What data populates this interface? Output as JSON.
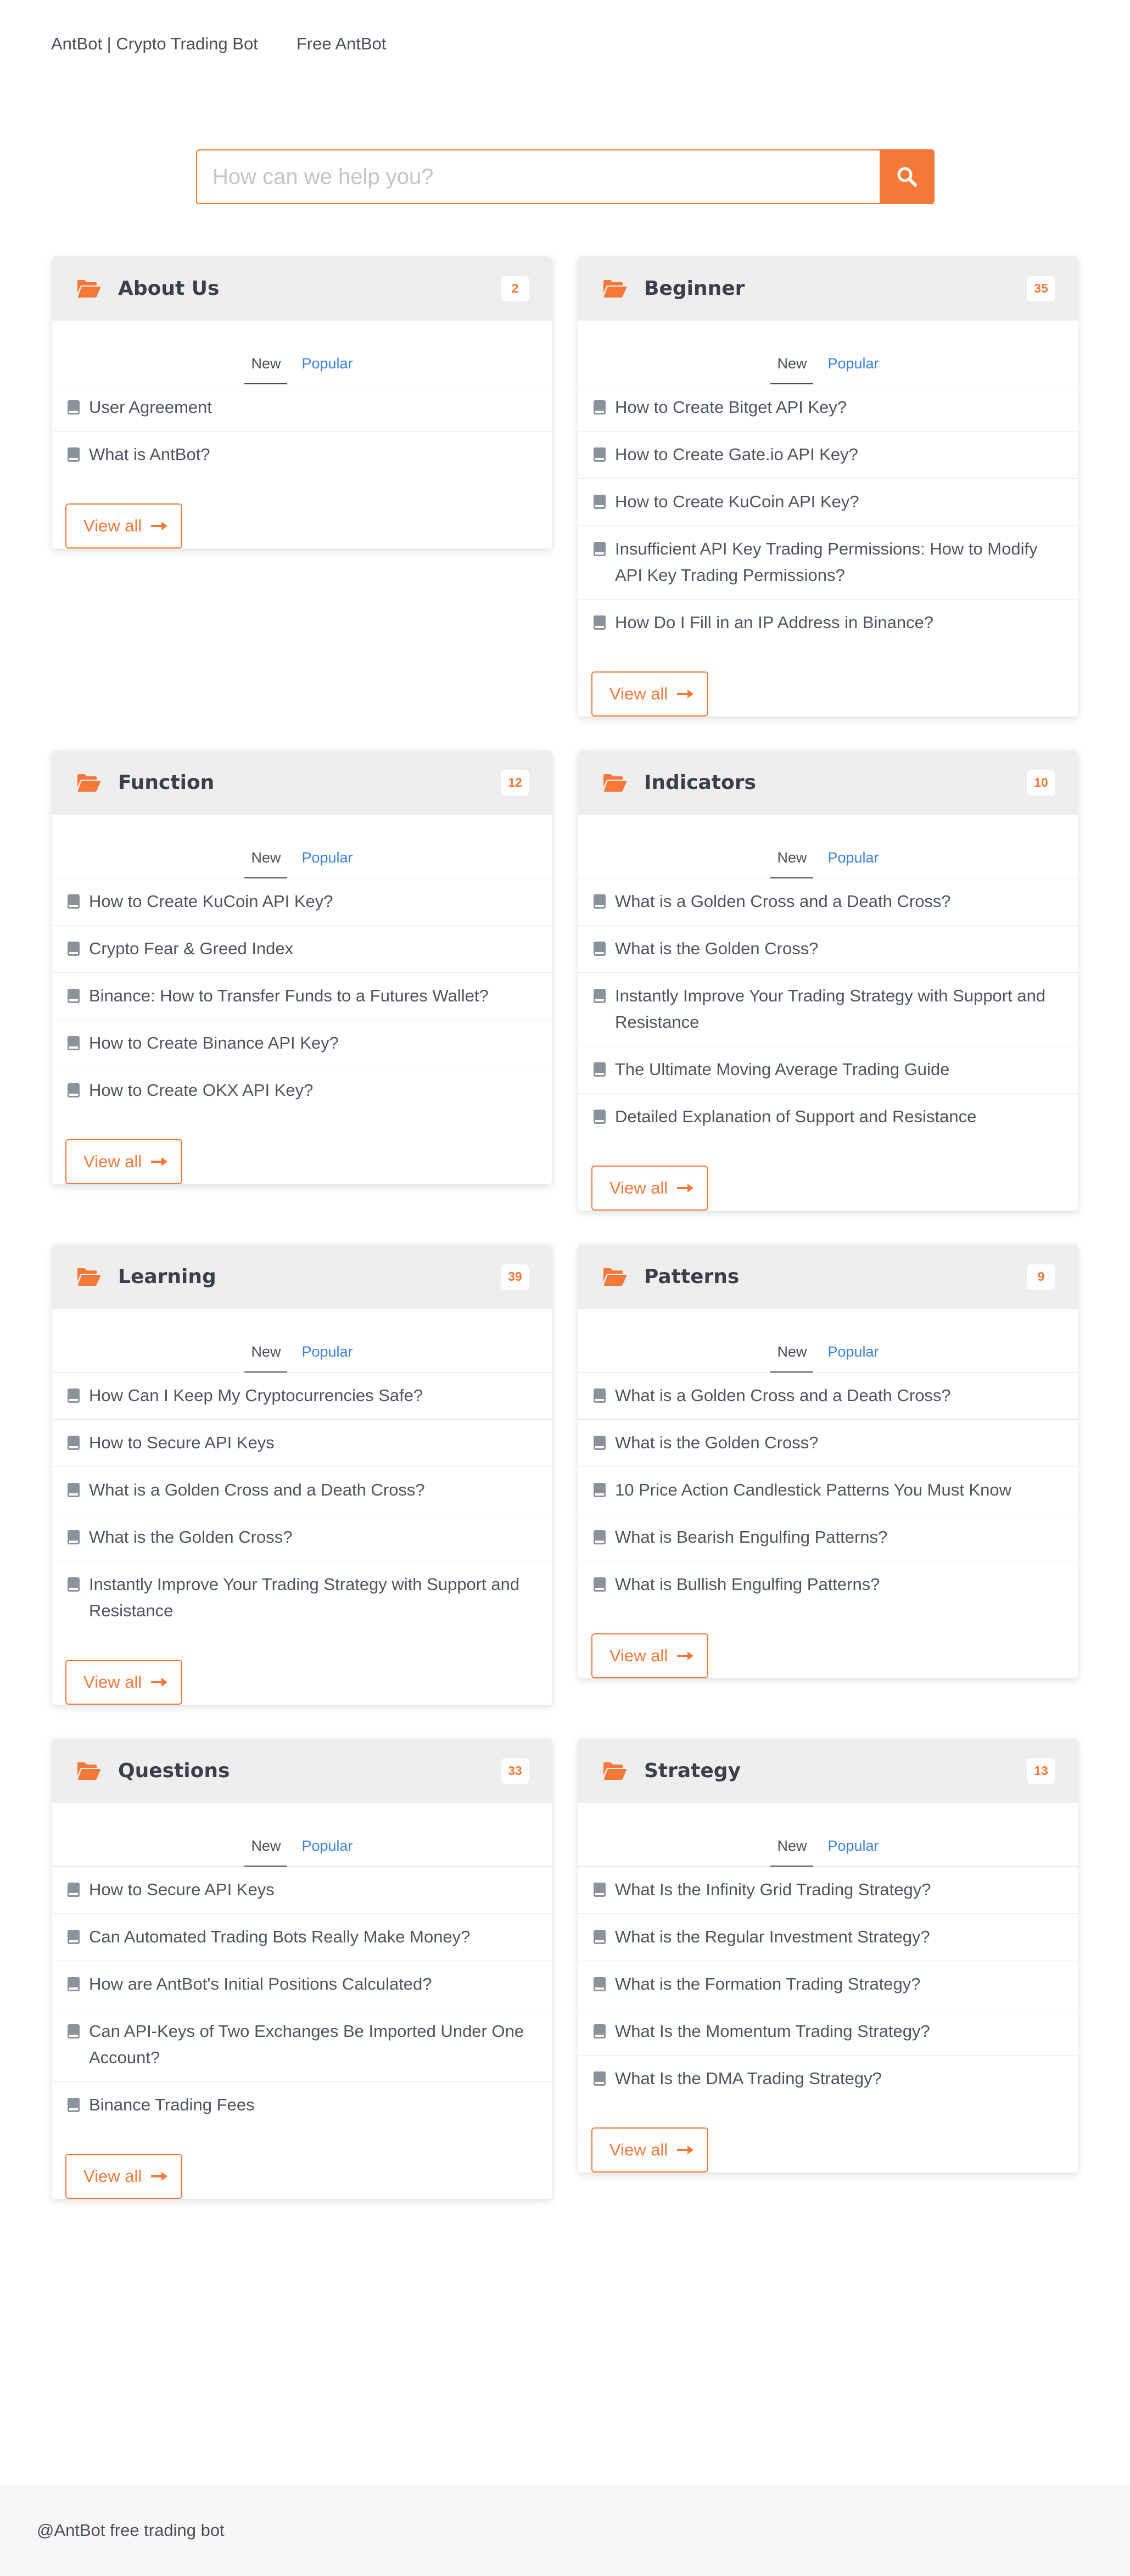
{
  "nav": {
    "brand": "AntBot | Crypto Trading Bot",
    "free_link": "Free AntBot"
  },
  "search": {
    "placeholder": "How can we help you?",
    "icon": "search-icon"
  },
  "colors": {
    "accent": "#f47838",
    "link": "#3b82dc",
    "header_bg": "#eeeeee",
    "icon_gray": "#8a929c"
  },
  "tabs": {
    "new": "New",
    "popular": "Popular"
  },
  "view_all_label": "View all",
  "categories": [
    {
      "title": "About Us",
      "count": "2",
      "articles": [
        "User Agreement",
        "What is AntBot?"
      ]
    },
    {
      "title": "Beginner",
      "count": "35",
      "articles": [
        "How to Create Bitget API Key?",
        "How to Create Gate.io API Key?",
        "How to Create KuCoin API Key?",
        "Insufficient API Key Trading Permissions: How to Modify API Key Trading Permissions?",
        "How Do I Fill in an IP Address in Binance?"
      ]
    },
    {
      "title": "Function",
      "count": "12",
      "articles": [
        "How to Create KuCoin API Key?",
        "Crypto Fear & Greed Index",
        "Binance: How to Transfer Funds to a Futures Wallet?",
        "How to Create Binance API Key?",
        "How to Create OKX API Key?"
      ]
    },
    {
      "title": "Indicators",
      "count": "10",
      "articles": [
        "What is a Golden Cross and a Death Cross?",
        "What is the Golden Cross?",
        "Instantly Improve Your Trading Strategy with Support and Resistance",
        "The Ultimate Moving Average Trading Guide",
        "Detailed Explanation of Support and Resistance"
      ]
    },
    {
      "title": "Learning",
      "count": "39",
      "articles": [
        "How Can I Keep My Cryptocurrencies Safe?",
        "How to Secure API Keys",
        "What is a Golden Cross and a Death Cross?",
        "What is the Golden Cross?",
        "Instantly Improve Your Trading Strategy with Support and Resistance"
      ]
    },
    {
      "title": "Patterns",
      "count": "9",
      "articles": [
        "What is a Golden Cross and a Death Cross?",
        "What is the Golden Cross?",
        "10  Price Action Candlestick Patterns You Must Know",
        "What is Bearish Engulfing Patterns?",
        "What is Bullish Engulfing Patterns?"
      ]
    },
    {
      "title": "Questions",
      "count": "33",
      "articles": [
        "How to Secure API Keys",
        "Can Automated Trading Bots Really Make Money?",
        "How are AntBot's Initial Positions Calculated?",
        "Can API-Keys of Two Exchanges Be Imported Under One Account?",
        "Binance Trading Fees"
      ]
    },
    {
      "title": "Strategy",
      "count": "13",
      "articles": [
        "What Is the Infinity Grid Trading Strategy?",
        "What is the Regular Investment Strategy?",
        "What is the Formation Trading Strategy?",
        "What Is the Momentum Trading Strategy?",
        "What Is the DMA Trading Strategy?"
      ]
    }
  ],
  "footer": {
    "text": "@AntBot free trading bot"
  }
}
